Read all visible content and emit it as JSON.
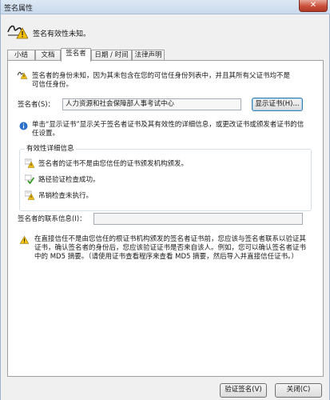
{
  "window": {
    "title": "签名属性",
    "close_label": "✕"
  },
  "header": {
    "status_text": "签名有效性未知。"
  },
  "tabs": [
    {
      "label": "小结"
    },
    {
      "label": "文档"
    },
    {
      "label": "签名者"
    },
    {
      "label": "日期 / 时间"
    },
    {
      "label": "法律声明"
    }
  ],
  "signer_tab": {
    "identity_message": "签名者的身份未知，因为其未包含在您的可信任身份列表中，并且其所有父证书均不是可信任身份。",
    "signer_label": "签名者(S)：",
    "signer_value": "人力资源和社会保障部人事考试中心",
    "show_cert_button": "显示证书(H)...",
    "info_message": "单击“显示证书”显示关于签名者证书及其有效性的详细信息，或更改证书或颁发者证书的信任设置。",
    "validity_group_title": "有效性详细信息",
    "validity_items": [
      {
        "text": "签名者的证书不是由您信任的证书颁发机构颁发。",
        "icon": "warning-cert-icon"
      },
      {
        "text": "路径验证检查成功。",
        "icon": "valid-path-icon"
      },
      {
        "text": "吊销检查未执行。",
        "icon": "warning-revocation-icon"
      }
    ],
    "contact_label": "签名者的联系信息(I)：",
    "contact_value": "",
    "bottom_warning": "在直接信任不是由您信任的根证书机构颁发的签名者证书前，您应该与签名者联系以验证其证书，确认签名者的身份后，您应该验证证书是否来自该人。例如，您可以确认签名者证书中的 MD5 摘要。（请使用证书查看程序来查看 MD5 摘要，然后导入并直接信任证书。）"
  },
  "footer": {
    "validate_button": "验证签名(V)",
    "close_button": "关闭(C)"
  },
  "colors": {
    "warning_yellow": "#f5c211",
    "info_blue": "#2a6fc9",
    "check_green": "#3a9a2a"
  }
}
